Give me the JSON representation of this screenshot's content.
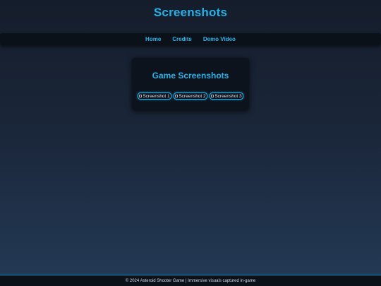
{
  "header": {
    "title": "Screenshots"
  },
  "nav": {
    "items": [
      {
        "label": "Home"
      },
      {
        "label": "Credits"
      },
      {
        "label": "Demo Video"
      }
    ]
  },
  "gallery": {
    "heading": "Game Screenshots",
    "thumbnails": [
      {
        "alt": "Screenshot 1"
      },
      {
        "alt": "Screenshot 2"
      },
      {
        "alt": "Screenshot 3"
      }
    ]
  },
  "footer": {
    "text": "© 2024 Asteroid Shooter Game | Immersive visuals captured in-game"
  },
  "colors": {
    "accent": "#1fb3e8",
    "background_top": "#151d2b",
    "background_bottom": "#243a56",
    "panel": "#0c131d"
  }
}
